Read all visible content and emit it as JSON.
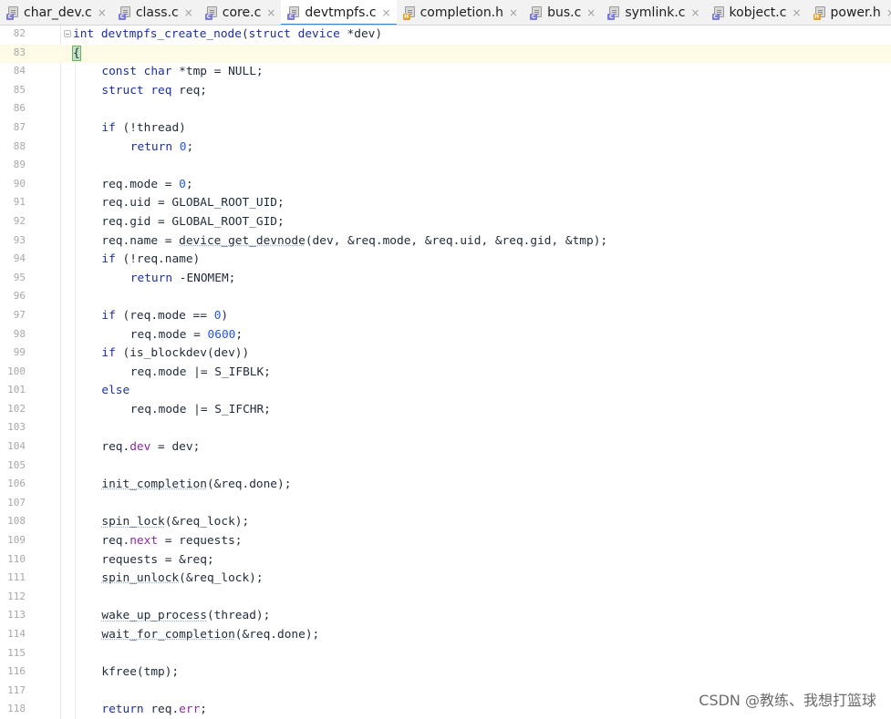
{
  "tabs": [
    {
      "label": "char_dev.c",
      "type": "c",
      "active": false
    },
    {
      "label": "class.c",
      "type": "c",
      "active": false
    },
    {
      "label": "core.c",
      "type": "c",
      "active": false
    },
    {
      "label": "devtmpfs.c",
      "type": "c",
      "active": true
    },
    {
      "label": "completion.h",
      "type": "h",
      "active": false
    },
    {
      "label": "bus.c",
      "type": "c",
      "active": false
    },
    {
      "label": "symlink.c",
      "type": "c",
      "active": false
    },
    {
      "label": "kobject.c",
      "type": "c",
      "active": false
    },
    {
      "label": "power.h",
      "type": "h",
      "active": false
    }
  ],
  "close_glyph": "×",
  "current_line": 83,
  "lines": [
    {
      "n": "82",
      "indent": 0,
      "tokens": [
        [
          "k",
          "int"
        ],
        [
          "t",
          " "
        ],
        [
          "f",
          "devtmpfs_create_node"
        ],
        [
          "t",
          "("
        ],
        [
          "k",
          "struct"
        ],
        [
          "t",
          " "
        ],
        [
          "k",
          "device"
        ],
        [
          "t",
          " *dev)"
        ]
      ]
    },
    {
      "n": "83",
      "indent": 0,
      "tokens": [
        [
          "brace",
          "{"
        ]
      ]
    },
    {
      "n": "84",
      "indent": 1,
      "tokens": [
        [
          "k",
          "const"
        ],
        [
          "t",
          " "
        ],
        [
          "k",
          "char"
        ],
        [
          "t",
          " *tmp = NULL;"
        ]
      ]
    },
    {
      "n": "85",
      "indent": 1,
      "tokens": [
        [
          "k",
          "struct"
        ],
        [
          "t",
          " "
        ],
        [
          "k",
          "req"
        ],
        [
          "t",
          " req;"
        ]
      ]
    },
    {
      "n": "86",
      "indent": 0,
      "tokens": []
    },
    {
      "n": "87",
      "indent": 1,
      "tokens": [
        [
          "k",
          "if"
        ],
        [
          "t",
          " (!thread)"
        ]
      ]
    },
    {
      "n": "88",
      "indent": 2,
      "tokens": [
        [
          "k",
          "return"
        ],
        [
          "t",
          " "
        ],
        [
          "n",
          "0"
        ],
        [
          "t",
          ";"
        ]
      ]
    },
    {
      "n": "89",
      "indent": 0,
      "tokens": []
    },
    {
      "n": "90",
      "indent": 1,
      "tokens": [
        [
          "t",
          "req.mode = "
        ],
        [
          "n",
          "0"
        ],
        [
          "t",
          ";"
        ]
      ]
    },
    {
      "n": "91",
      "indent": 1,
      "tokens": [
        [
          "t",
          "req.uid = GLOBAL_ROOT_UID;"
        ]
      ]
    },
    {
      "n": "92",
      "indent": 1,
      "tokens": [
        [
          "t",
          "req.gid = GLOBAL_ROOT_GID;"
        ]
      ]
    },
    {
      "n": "93",
      "indent": 1,
      "tokens": [
        [
          "t",
          "req.name = "
        ],
        [
          "u",
          "device_get_devnode"
        ],
        [
          "t",
          "(dev, &req.mode, &req.uid, &req.gid, &tmp);"
        ]
      ]
    },
    {
      "n": "94",
      "indent": 1,
      "tokens": [
        [
          "k",
          "if"
        ],
        [
          "t",
          " (!req.name)"
        ]
      ]
    },
    {
      "n": "95",
      "indent": 2,
      "tokens": [
        [
          "k",
          "return"
        ],
        [
          "t",
          " -ENOMEM;"
        ]
      ]
    },
    {
      "n": "96",
      "indent": 0,
      "tokens": []
    },
    {
      "n": "97",
      "indent": 1,
      "tokens": [
        [
          "k",
          "if"
        ],
        [
          "t",
          " (req.mode == "
        ],
        [
          "n",
          "0"
        ],
        [
          "t",
          ")"
        ]
      ]
    },
    {
      "n": "98",
      "indent": 2,
      "tokens": [
        [
          "t",
          "req.mode = "
        ],
        [
          "n",
          "0600"
        ],
        [
          "t",
          ";"
        ]
      ]
    },
    {
      "n": "99",
      "indent": 1,
      "tokens": [
        [
          "k",
          "if"
        ],
        [
          "t",
          " (is_blockdev(dev))"
        ]
      ]
    },
    {
      "n": "100",
      "indent": 2,
      "tokens": [
        [
          "t",
          "req.mode |= S_IFBLK;"
        ]
      ]
    },
    {
      "n": "101",
      "indent": 1,
      "tokens": [
        [
          "k",
          "else"
        ]
      ]
    },
    {
      "n": "102",
      "indent": 2,
      "tokens": [
        [
          "t",
          "req.mode |= S_IFCHR;"
        ]
      ]
    },
    {
      "n": "103",
      "indent": 0,
      "tokens": []
    },
    {
      "n": "104",
      "indent": 1,
      "tokens": [
        [
          "t",
          "req."
        ],
        [
          "m",
          "dev"
        ],
        [
          "t",
          " = dev;"
        ]
      ]
    },
    {
      "n": "105",
      "indent": 0,
      "tokens": []
    },
    {
      "n": "106",
      "indent": 1,
      "tokens": [
        [
          "u",
          "init_completion"
        ],
        [
          "t",
          "(&req.done);"
        ]
      ]
    },
    {
      "n": "107",
      "indent": 0,
      "tokens": []
    },
    {
      "n": "108",
      "indent": 1,
      "tokens": [
        [
          "u",
          "spin_lock"
        ],
        [
          "t",
          "(&req_lock);"
        ]
      ]
    },
    {
      "n": "109",
      "indent": 1,
      "tokens": [
        [
          "t",
          "req."
        ],
        [
          "m",
          "next"
        ],
        [
          "t",
          " = requests;"
        ]
      ]
    },
    {
      "n": "110",
      "indent": 1,
      "tokens": [
        [
          "t",
          "requests = &req;"
        ]
      ]
    },
    {
      "n": "111",
      "indent": 1,
      "tokens": [
        [
          "u",
          "spin_unlock"
        ],
        [
          "t",
          "(&req_lock);"
        ]
      ]
    },
    {
      "n": "112",
      "indent": 0,
      "tokens": []
    },
    {
      "n": "113",
      "indent": 1,
      "tokens": [
        [
          "u",
          "wake_up_process"
        ],
        [
          "t",
          "(thread);"
        ]
      ]
    },
    {
      "n": "114",
      "indent": 1,
      "tokens": [
        [
          "u",
          "wait_for_completion"
        ],
        [
          "t",
          "(&req.done);"
        ]
      ]
    },
    {
      "n": "115",
      "indent": 0,
      "tokens": []
    },
    {
      "n": "116",
      "indent": 1,
      "tokens": [
        [
          "t",
          "kfree(tmp);"
        ]
      ]
    },
    {
      "n": "117",
      "indent": 0,
      "tokens": []
    },
    {
      "n": "118",
      "indent": 1,
      "tokens": [
        [
          "k",
          "return"
        ],
        [
          "t",
          " req."
        ],
        [
          "m",
          "err"
        ],
        [
          "t",
          ";"
        ]
      ]
    }
  ],
  "watermark": "CSDN @教练、我想打篮球",
  "colors": {
    "keyword": "#1b2fa0",
    "number": "#2758d8",
    "member": "#8a2a9e",
    "active_tab_underline": "#4083c9",
    "current_line_bg": "#fdfbe6"
  }
}
